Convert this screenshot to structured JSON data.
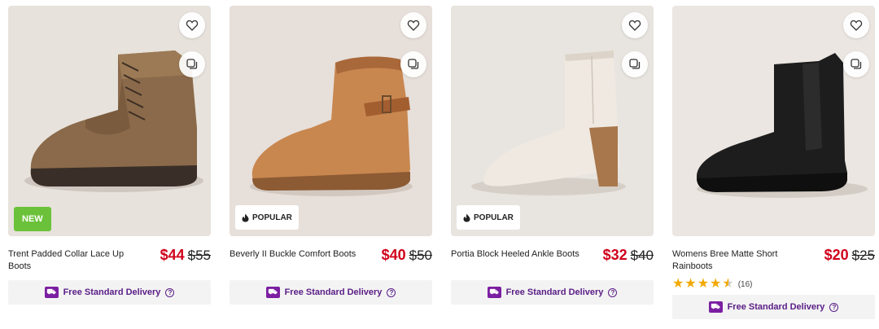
{
  "products": [
    {
      "title": "Trent Padded Collar Lace Up Boots",
      "price_now": "$44",
      "price_was": "$55",
      "badge": "NEW",
      "delivery": "Free Standard Delivery"
    },
    {
      "title": "Beverly II Buckle Comfort Boots",
      "price_now": "$40",
      "price_was": "$50",
      "badge": "POPULAR",
      "delivery": "Free Standard Delivery"
    },
    {
      "title": "Portia Block Heeled Ankle Boots",
      "price_now": "$32",
      "price_was": "$40",
      "badge": "POPULAR",
      "delivery": "Free Standard Delivery"
    },
    {
      "title": "Womens Bree Matte Short Rainboots",
      "price_now": "$20",
      "price_was": "$25",
      "rating": 4.5,
      "review_count": "(16)",
      "delivery": "Free Standard Delivery"
    }
  ],
  "icons": {
    "wishlist": "heart-icon",
    "compare": "compare-icon",
    "popular": "flame-icon",
    "delivery": "truck-icon",
    "help": "help-icon"
  },
  "colors": {
    "price_sale": "#d0021b",
    "new_badge": "#6bc23a",
    "delivery_text": "#5a1d86",
    "star": "#f2a900"
  }
}
